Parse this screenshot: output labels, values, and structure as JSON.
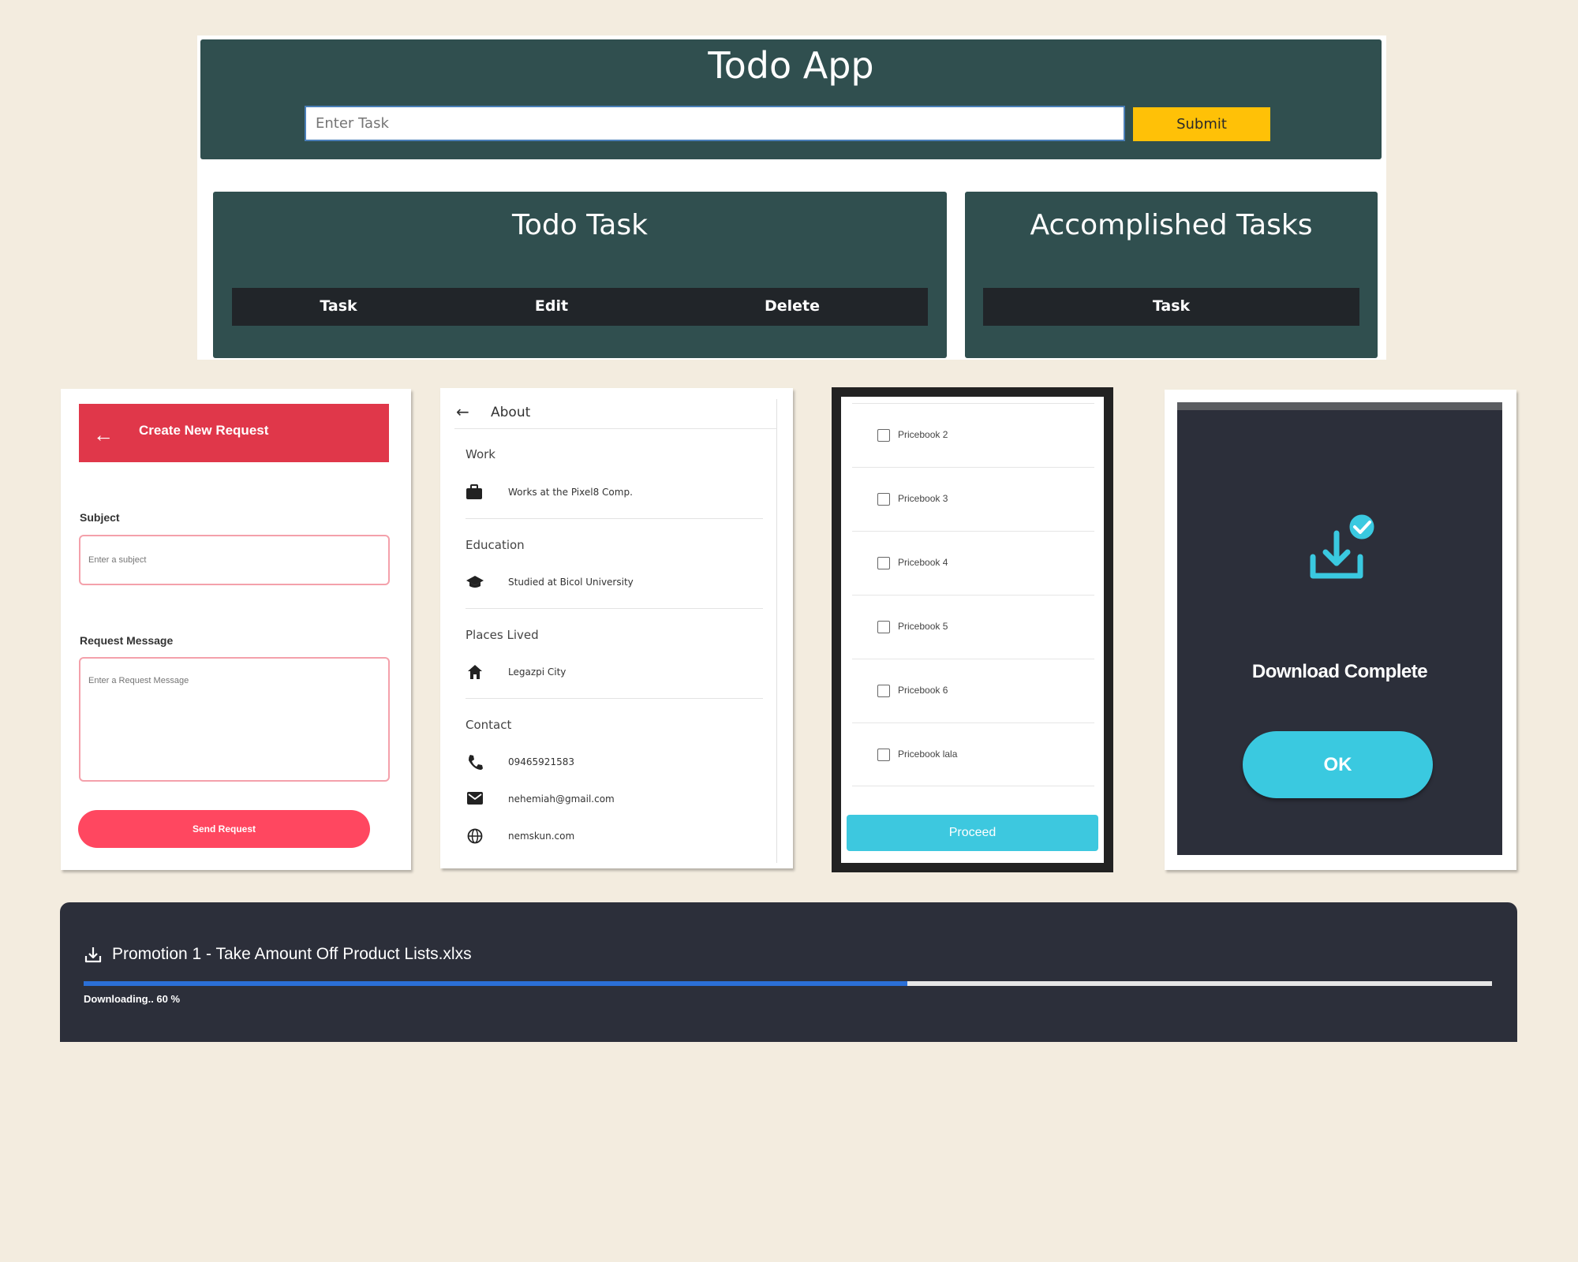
{
  "todo": {
    "title": "Todo App",
    "input_placeholder": "Enter Task",
    "submit_label": "Submit",
    "todo_panel_title": "Todo Task",
    "todo_columns": [
      "Task",
      "Edit",
      "Delete"
    ],
    "accomplished_panel_title": "Accomplished Tasks",
    "accomplished_columns": [
      "Task"
    ]
  },
  "request": {
    "title": "Create New Request",
    "subject_label": "Subject",
    "subject_placeholder": "Enter a subject",
    "message_label": "Request Message",
    "message_placeholder": "Enter a Request Message",
    "send_label": "Send Request"
  },
  "about": {
    "title": "About",
    "sections": [
      {
        "label": "Work",
        "items": [
          {
            "icon": "briefcase-icon",
            "text": "Works at the Pixel8 Comp."
          }
        ]
      },
      {
        "label": "Education",
        "items": [
          {
            "icon": "graduation-cap-icon",
            "text": "Studied at Bicol University"
          }
        ]
      },
      {
        "label": "Places Lived",
        "items": [
          {
            "icon": "home-icon",
            "text": "Legazpi City"
          }
        ]
      },
      {
        "label": "Contact",
        "items": [
          {
            "icon": "phone-icon",
            "text": "09465921583"
          },
          {
            "icon": "email-icon",
            "text": "nehemiah@gmail.com"
          },
          {
            "icon": "globe-icon",
            "text": "nemskun.com"
          }
        ]
      }
    ]
  },
  "pricebook": {
    "items": [
      "Pricebook 2",
      "Pricebook 3",
      "Pricebook 4",
      "Pricebook 5",
      "Pricebook 6",
      "Pricebook lala"
    ],
    "proceed_label": "Proceed"
  },
  "download_dialog": {
    "title": "Download Complete",
    "ok_label": "OK",
    "accent": "#3ac9e0"
  },
  "download_progress": {
    "filename": "Promotion 1 - Take Amount Off Product Lists.xlxs",
    "status": "Downloading.. 60 %",
    "progress": 0.585
  }
}
